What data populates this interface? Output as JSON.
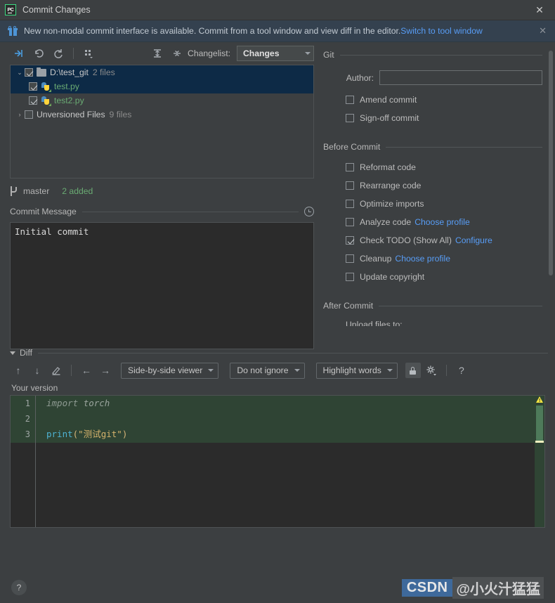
{
  "window": {
    "app_icon": "pycharm-icon",
    "title": "Commit Changes",
    "close_label": "✕"
  },
  "banner": {
    "icon": "gift-icon",
    "text": "New non-modal commit interface is available. Commit from a tool window and view diff in the editor.",
    "link": "Switch to tool window",
    "close_label": "✕"
  },
  "toolbar": {
    "buttons": [
      {
        "name": "show-diff-icon",
        "glyph": "⇥"
      },
      {
        "name": "revert-icon",
        "glyph": "↶"
      },
      {
        "name": "refresh-icon",
        "glyph": "↻"
      },
      {
        "name": "group-by-icon",
        "glyph": "░"
      },
      {
        "name": "expand-all-icon",
        "glyph": "≡"
      },
      {
        "name": "collapse-all-icon",
        "glyph": "≡"
      }
    ],
    "changelist_label": "Changelist:",
    "changelist_value": "Changes"
  },
  "file_tree": {
    "rows": [
      {
        "name": "tree-row-folder",
        "twisty": "⌄",
        "checked": true,
        "icon": "folder-icon",
        "label": "D:\\test_git",
        "label_color": "normal",
        "count": "2 files",
        "indent": 0,
        "selected": false
      },
      {
        "name": "tree-row-test-py",
        "twisty": "",
        "checked": true,
        "icon": "python-file-icon",
        "label": "test.py",
        "label_color": "green",
        "count": "",
        "indent": 1,
        "selected": true
      },
      {
        "name": "tree-row-test2-py",
        "twisty": "",
        "checked": true,
        "icon": "python-file-icon",
        "label": "test2.py",
        "label_color": "green",
        "count": "",
        "indent": 1,
        "selected": false
      },
      {
        "name": "tree-row-unversioned",
        "twisty": "›",
        "checked": false,
        "icon": "none",
        "label": "Unversioned Files",
        "label_color": "normal",
        "count": "9 files",
        "indent": 0,
        "selected": false
      }
    ]
  },
  "branch_bar": {
    "icon": "branch-icon",
    "branch": "master",
    "status": "2 added"
  },
  "commit_message": {
    "section_label": "Commit Message",
    "history_icon": "clock-icon",
    "value": "Initial commit",
    "placeholder": ""
  },
  "git_panel": {
    "group_git": "Git",
    "author_label": "Author:",
    "author_value": "",
    "author_placeholder": "",
    "git_options": [
      {
        "name": "amend-commit-checkbox",
        "label": "Amend commit",
        "checked": false
      },
      {
        "name": "sign-off-commit-checkbox",
        "label": "Sign-off commit",
        "checked": false
      }
    ],
    "group_before": "Before Commit",
    "before_options": [
      {
        "name": "reformat-code-checkbox",
        "label": "Reformat code",
        "checked": false,
        "link": ""
      },
      {
        "name": "rearrange-code-checkbox",
        "label": "Rearrange code",
        "checked": false,
        "link": ""
      },
      {
        "name": "optimize-imports-checkbox",
        "label": "Optimize imports",
        "checked": false,
        "link": ""
      },
      {
        "name": "analyze-code-checkbox",
        "label": "Analyze code",
        "checked": false,
        "link": "Choose profile"
      },
      {
        "name": "check-todo-checkbox",
        "label": "Check TODO (Show All)",
        "checked": true,
        "link": "Configure"
      },
      {
        "name": "cleanup-checkbox",
        "label": "Cleanup",
        "checked": false,
        "link": "Choose profile"
      },
      {
        "name": "update-copyright-checkbox",
        "label": "Update copyright",
        "checked": false,
        "link": ""
      }
    ],
    "group_after": "After Commit",
    "after_clipped_label": "Upload files to:"
  },
  "diff": {
    "section_label": "Diff",
    "toolbar_icons": [
      {
        "name": "previous-difference-icon",
        "glyph": "↑"
      },
      {
        "name": "next-difference-icon",
        "glyph": "↓"
      },
      {
        "name": "annotate-icon",
        "glyph": "✎"
      },
      {
        "name": "apply-left-icon",
        "glyph": "←"
      },
      {
        "name": "apply-right-icon",
        "glyph": "→"
      }
    ],
    "viewer_mode": "Side-by-side viewer",
    "whitespace_mode": "Do not ignore",
    "highlight_mode": "Highlight words",
    "lock_icon": "lock-icon",
    "settings_icon": "gear-icon",
    "help_icon": "question-mark-icon",
    "pane_label": "Your version",
    "lines": [
      {
        "num": "1",
        "segments": [
          {
            "text": "import",
            "cls": "tok-kw"
          },
          {
            "text": " ",
            "cls": ""
          },
          {
            "text": "torch",
            "cls": "tok-mod"
          }
        ]
      },
      {
        "num": "2",
        "segments": []
      },
      {
        "num": "3",
        "segments": [
          {
            "text": "print",
            "cls": "tok-fn"
          },
          {
            "text": "(",
            "cls": "tok-paren"
          },
          {
            "text": "\"测试git\"",
            "cls": "tok-str"
          },
          {
            "text": ")",
            "cls": "tok-paren"
          }
        ]
      }
    ],
    "warning_icon": "warning-triangle-icon",
    "warning_glyph": "!"
  },
  "footer": {
    "help_label": "?",
    "watermark_brand": "CSDN",
    "watermark_user": "@小火汁猛猛"
  },
  "colors": {
    "window_bg": "#3c3f41",
    "banner_bg": "#34414f",
    "link": "#589df6",
    "selected_row": "#0d2a46",
    "editor_bg": "#2b2b2b",
    "diff_added": "#2f4434",
    "green_text": "#6aab73",
    "warning": "#f5e642"
  }
}
